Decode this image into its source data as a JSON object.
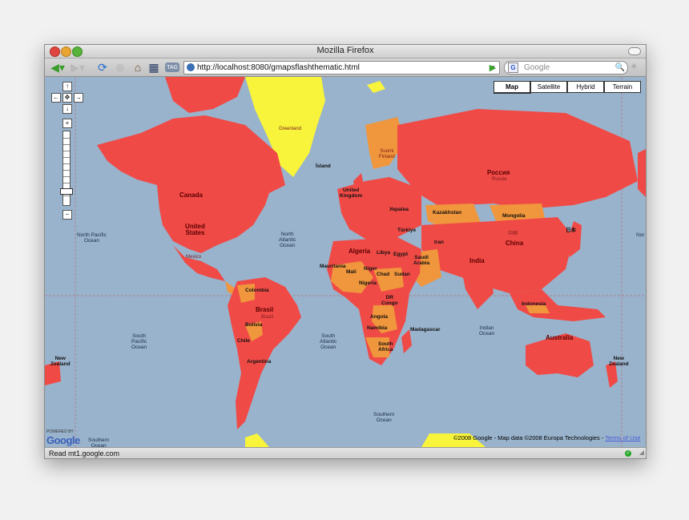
{
  "window": {
    "title": "Mozilla Firefox"
  },
  "toolbar": {
    "back_icon": "back-arrow-icon",
    "forward_icon": "forward-arrow-icon",
    "reload_icon": "reload-icon",
    "stop_icon": "stop-icon",
    "home_icon": "home-icon",
    "bookmark_icon": "bookmark-icon",
    "tag_label": "TAG",
    "url": "http://localhost:8080/gmapsflashthematic.html",
    "search_placeholder": "Google",
    "search_engine_letter": "G"
  },
  "map": {
    "map_types": [
      "Map",
      "Satellite",
      "Hybrid",
      "Terrain"
    ],
    "selected_map_type": "Map",
    "zoom_controls": {
      "up": "↑",
      "left": "←",
      "center": "✥",
      "right": "→",
      "down": "↓",
      "plus": "+",
      "minus": "−"
    },
    "labels": {
      "greenland": "Greenland",
      "canada": "Canada",
      "united_states": "United\nStates",
      "mexico": "Mexico",
      "colombia": "Colombia",
      "brasil": "Brasil",
      "brasil_sub": "Brazil",
      "bolivia": "Bolivia",
      "chile": "Chile",
      "argentina": "Argentina",
      "iceland": "Ísland",
      "united_kingdom": "United\nKingdom",
      "algeria": "Algeria",
      "libya": "Libya",
      "egypt": "Egypt",
      "mauritania": "Mauritania",
      "mali": "Mali",
      "niger": "Niger",
      "chad": "Chad",
      "sudan": "Sudan",
      "nigeria": "Nigeria",
      "drc": "DR\nCongo",
      "angola": "Angola",
      "namibia": "Namibia",
      "south_africa": "South\nAfrica",
      "madagascar": "Madagascar",
      "saudi_arabia": "Saudi\nArabia",
      "iran": "Iran",
      "india": "India",
      "china": "China",
      "china_native": "中国",
      "russia_native": "Россия",
      "russia": "Russia",
      "kazakhstan": "Kazakhstan",
      "mongolia": "Mongolia",
      "turkey": "Türkiye",
      "ukraine": "Україна",
      "finland": "Suomi\nFinland",
      "japan": "日本",
      "australia": "Australia",
      "new_zealand_left": "New\nZealand",
      "new_zealand_right": "New\nZealand",
      "indonesia": "Indonesia"
    },
    "oceans": {
      "north_pacific": "North Pacific\nOcean",
      "north_atlantic": "North\nAtlantic\nOcean",
      "south_pacific": "South\nPacific\nOcean",
      "south_atlantic": "South\nAtlantic\nOcean",
      "indian": "Indian\nOcean",
      "southern": "Southern\nOcean",
      "southern_left": "Southern\nOcean",
      "north_right": "Nor"
    },
    "copyright": "©2008 Google - Map data ©2008  Europa Technologies - ",
    "terms_link": "Terms of Use",
    "powered_by": "POWERED BY",
    "google_logo": "Google"
  },
  "colors": {
    "ocean": "#99b3cc",
    "high": "#f04a46",
    "medium": "#f0963c",
    "low": "#f8f43c"
  },
  "status": {
    "text": "Read mt1.google.com"
  }
}
